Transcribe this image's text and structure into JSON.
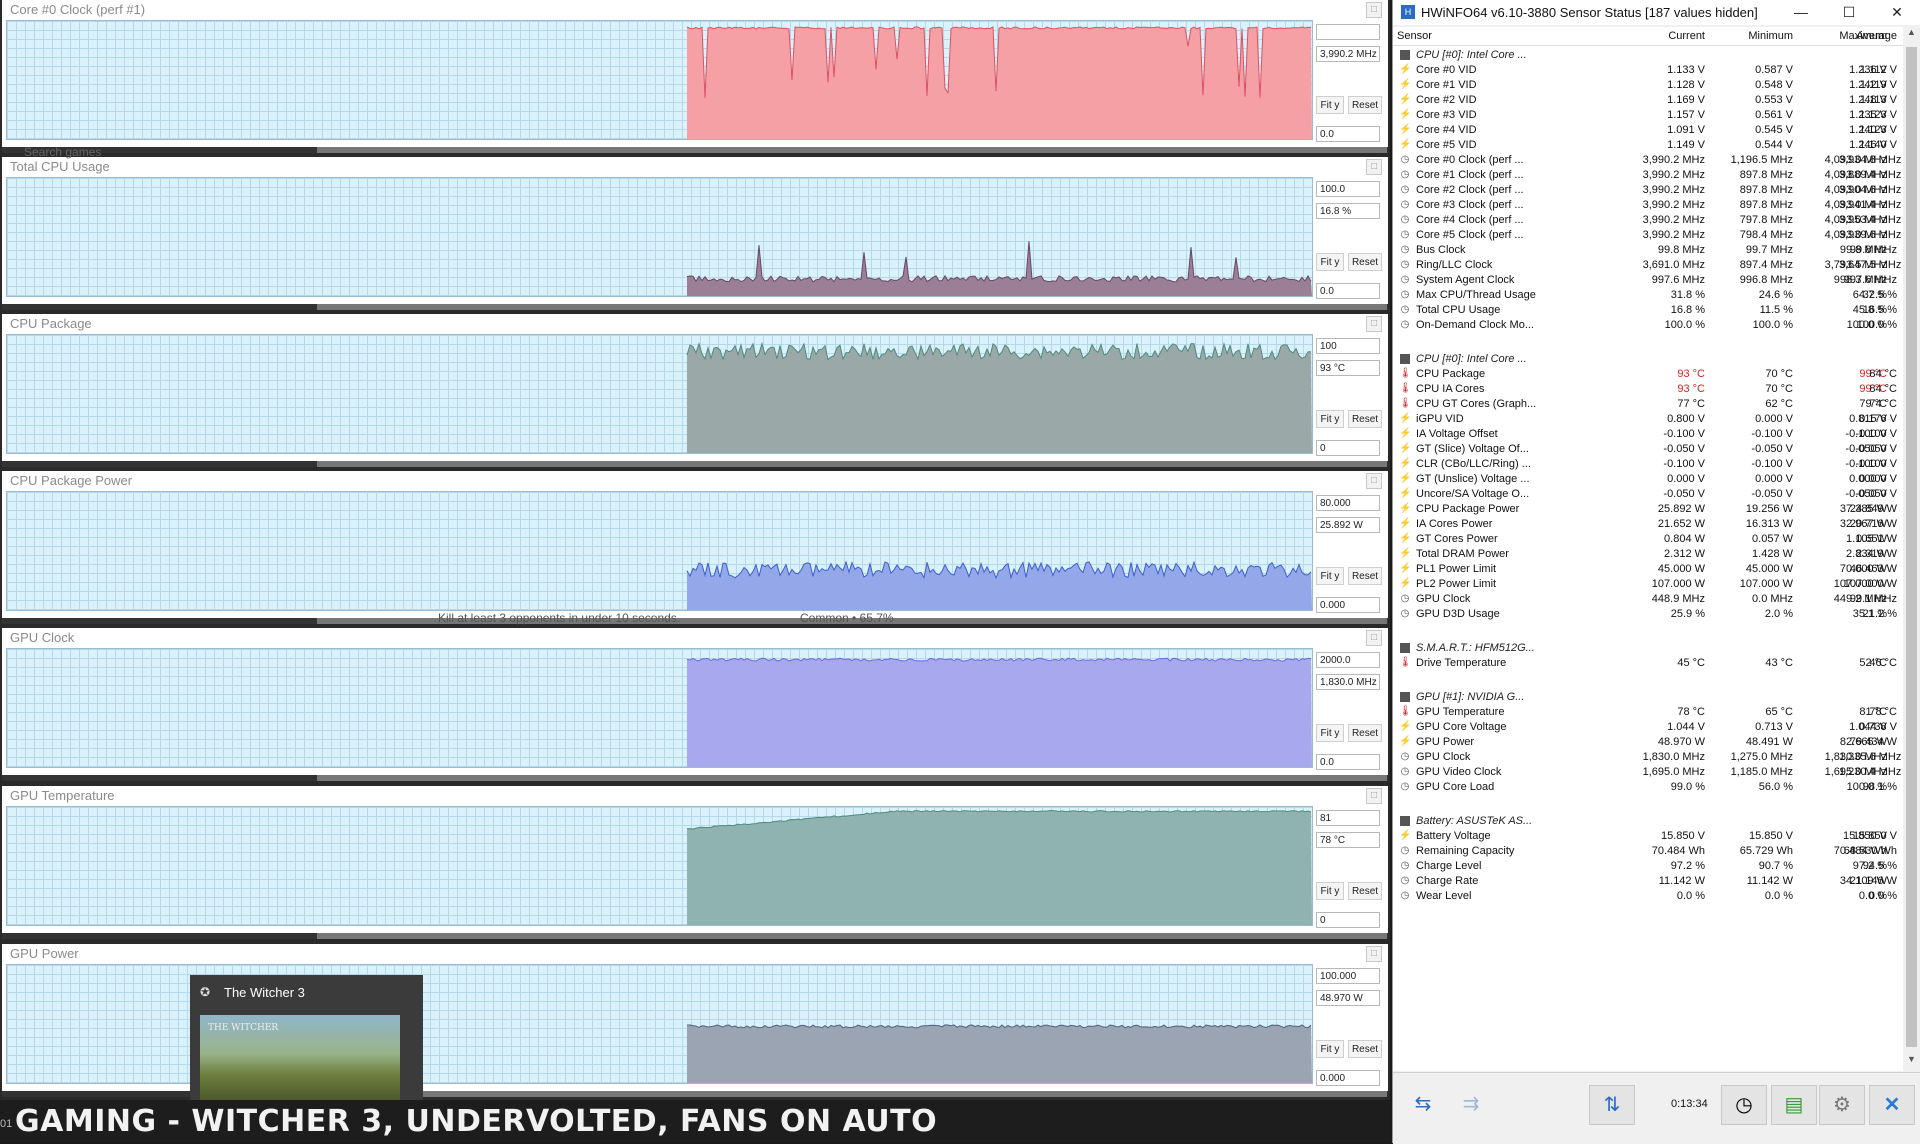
{
  "graphs": [
    {
      "title": "Core #0 Clock (perf #1)",
      "top_value": "",
      "current": "3,990.2 MHz",
      "bottom": "0.0",
      "fit": "Fit y",
      "reset": "Reset",
      "color": "#f4a0a4",
      "stroke": "#e05060",
      "baseline": 0.05,
      "shape": "dips"
    },
    {
      "title": "Total CPU Usage",
      "top_value": "100.0",
      "current": "16.8 %",
      "bottom": "0.0",
      "fit": "Fit y",
      "reset": "Reset",
      "color": "#9a7f96",
      "stroke": "#6a4766",
      "baseline": 0.88,
      "shape": "low"
    },
    {
      "title": "CPU Package",
      "top_value": "100",
      "current": "93 °C",
      "bottom": "0",
      "fit": "Fit y",
      "reset": "Reset",
      "color": "#9aa9a8",
      "stroke": "#4f8a7a",
      "baseline": 0.14,
      "shape": "noisy"
    },
    {
      "title": "CPU Package Power",
      "top_value": "80.000",
      "current": "25.892 W",
      "bottom": "0.000",
      "fit": "Fit y",
      "reset": "Reset",
      "color": "#93a7e9",
      "stroke": "#3c5fd0",
      "baseline": 0.66,
      "shape": "noisy"
    },
    {
      "title": "GPU Clock",
      "top_value": "2000.0",
      "current": "1,830.0 MHz",
      "bottom": "0.0",
      "fit": "Fit y",
      "reset": "Reset",
      "color": "#a8a8ee",
      "stroke": "#6a6ad8",
      "baseline": 0.09,
      "shape": "flat"
    },
    {
      "title": "GPU Temperature",
      "top_value": "81",
      "current": "78 °C",
      "bottom": "0",
      "fit": "Fit y",
      "reset": "Reset",
      "color": "#8fb3ae",
      "stroke": "#4f8a7a",
      "baseline": 0.03,
      "shape": "rise"
    },
    {
      "title": "GPU Power",
      "top_value": "100.000",
      "current": "48.970 W",
      "bottom": "0.000",
      "fit": "Fit y",
      "reset": "Reset",
      "color": "#9aa4b3",
      "stroke": "#4f5f80",
      "baseline": 0.52,
      "shape": "flat"
    }
  ],
  "overlay": {
    "search": "Search games",
    "challenge": "Kill at least 3 opponents in under 10 seconds.",
    "rarity": "Common • 65.7%",
    "popup_title": "The Witcher 3",
    "caption": "GAMING - WITCHER 3, UNDERVOLTED, FANS ON AUTO",
    "edge_label": "01"
  },
  "hwinfo": {
    "title": "HWiNFO64 v6.10-3880 Sensor Status [187 values hidden]",
    "columns": [
      "Sensor",
      "Current",
      "Minimum",
      "Maximum",
      "Average"
    ],
    "timer": "0:13:34",
    "rows": [
      {
        "type": "group",
        "name": "CPU [#0]: Intel Core ..."
      },
      {
        "icon": "bolt",
        "name": "Core #0 VID",
        "v": [
          "1.133 V",
          "0.587 V",
          "1.236 V",
          "1.112 V"
        ]
      },
      {
        "icon": "bolt",
        "name": "Core #1 VID",
        "v": [
          "1.128 V",
          "0.548 V",
          "1.242 V",
          "1.119 V"
        ]
      },
      {
        "icon": "bolt",
        "name": "Core #2 VID",
        "v": [
          "1.169 V",
          "0.553 V",
          "1.248 V",
          "1.113 V"
        ]
      },
      {
        "icon": "bolt",
        "name": "Core #3 VID",
        "v": [
          "1.157 V",
          "0.561 V",
          "1.235 V",
          "1.123 V"
        ]
      },
      {
        "icon": "bolt",
        "name": "Core #4 VID",
        "v": [
          "1.091 V",
          "0.545 V",
          "1.240 V",
          "1.123 V"
        ]
      },
      {
        "icon": "bolt",
        "name": "Core #5 VID",
        "v": [
          "1.149 V",
          "0.544 V",
          "1.246 V",
          "1.140 V"
        ]
      },
      {
        "icon": "clock",
        "name": "Core #0 Clock (perf ...",
        "v": [
          "3,990.2 MHz",
          "1,196.5 MHz",
          "4,093.0 MHz",
          "3,934.8 MHz"
        ]
      },
      {
        "icon": "clock",
        "name": "Core #1 Clock (perf ...",
        "v": [
          "3,990.2 MHz",
          "897.8 MHz",
          "4,093.0 MHz",
          "3,889.4 MHz"
        ]
      },
      {
        "icon": "clock",
        "name": "Core #2 Clock (perf ...",
        "v": [
          "3,990.2 MHz",
          "897.8 MHz",
          "4,093.0 MHz",
          "3,904.6 MHz"
        ]
      },
      {
        "icon": "clock",
        "name": "Core #3 Clock (perf ...",
        "v": [
          "3,990.2 MHz",
          "897.8 MHz",
          "4,093.0 MHz",
          "3,941.4 MHz"
        ]
      },
      {
        "icon": "clock",
        "name": "Core #4 Clock (perf ...",
        "v": [
          "3,990.2 MHz",
          "797.8 MHz",
          "4,093.0 MHz",
          "3,953.4 MHz"
        ]
      },
      {
        "icon": "clock",
        "name": "Core #5 Clock (perf ...",
        "v": [
          "3,990.2 MHz",
          "798.4 MHz",
          "4,093.0 MHz",
          "3,939.6 MHz"
        ]
      },
      {
        "icon": "clock",
        "name": "Bus Clock",
        "v": [
          "99.8 MHz",
          "99.7 MHz",
          "99.8 MHz",
          "99.8 MHz"
        ]
      },
      {
        "icon": "clock",
        "name": "Ring/LLC Clock",
        "v": [
          "3,691.0 MHz",
          "897.4 MHz",
          "3,793.5 MHz",
          "3,647.5 MHz"
        ]
      },
      {
        "icon": "clock",
        "name": "System Agent Clock",
        "v": [
          "997.6 MHz",
          "996.8 MHz",
          "998.3 MHz",
          "997.6 MHz"
        ]
      },
      {
        "icon": "clock",
        "name": "Max CPU/Thread Usage",
        "v": [
          "31.8 %",
          "24.6 %",
          "64.7 %",
          "32.5 %"
        ]
      },
      {
        "icon": "clock",
        "name": "Total CPU Usage",
        "v": [
          "16.8 %",
          "11.5 %",
          "45.8 %",
          "16.5 %"
        ]
      },
      {
        "icon": "clock",
        "name": "On-Demand Clock Mo...",
        "v": [
          "100.0 %",
          "100.0 %",
          "100.0 %",
          "100.0 %"
        ]
      },
      {
        "type": "spacer"
      },
      {
        "type": "group",
        "name": "CPU [#0]: Intel Core ..."
      },
      {
        "icon": "temp",
        "name": "CPU Package",
        "v": [
          "93 °C",
          "70 °C",
          "99 °C",
          "84 °C"
        ],
        "hot": [
          0,
          2
        ]
      },
      {
        "icon": "temp",
        "name": "CPU IA Cores",
        "v": [
          "93 °C",
          "70 °C",
          "99 °C",
          "84 °C"
        ],
        "hot": [
          0,
          2
        ]
      },
      {
        "icon": "temp",
        "name": "CPU GT Cores (Graph...",
        "v": [
          "77 °C",
          "62 °C",
          "79 °C",
          "74 °C"
        ]
      },
      {
        "icon": "bolt",
        "name": "iGPU VID",
        "v": [
          "0.800 V",
          "0.000 V",
          "0.815 V",
          "0.176 V"
        ]
      },
      {
        "icon": "bolt",
        "name": "IA Voltage Offset",
        "v": [
          "-0.100 V",
          "-0.100 V",
          "-0.100 V",
          "-0.100 V"
        ]
      },
      {
        "icon": "bolt",
        "name": "GT (Slice) Voltage Of...",
        "v": [
          "-0.050 V",
          "-0.050 V",
          "-0.050 V",
          "-0.050 V"
        ]
      },
      {
        "icon": "bolt",
        "name": "CLR (CBo/LLC/Ring) ...",
        "v": [
          "-0.100 V",
          "-0.100 V",
          "-0.100 V",
          "-0.100 V"
        ]
      },
      {
        "icon": "bolt",
        "name": "GT (Unslice) Voltage ...",
        "v": [
          "0.000 V",
          "0.000 V",
          "0.000 V",
          "0.000 V"
        ]
      },
      {
        "icon": "bolt",
        "name": "Uncore/SA Voltage O...",
        "v": [
          "-0.050 V",
          "-0.050 V",
          "-0.050 V",
          "-0.050 V"
        ]
      },
      {
        "icon": "bolt",
        "name": "CPU Package Power",
        "v": [
          "25.892 W",
          "19.256 W",
          "37.385 W",
          "24.849 W"
        ]
      },
      {
        "icon": "bolt",
        "name": "IA Cores Power",
        "v": [
          "21.652 W",
          "16.313 W",
          "32.967 W",
          "20.716 W"
        ]
      },
      {
        "icon": "bolt",
        "name": "GT Cores Power",
        "v": [
          "0.804 W",
          "0.057 W",
          "1.105 W",
          "0.651 W"
        ]
      },
      {
        "icon": "bolt",
        "name": "Total DRAM Power",
        "v": [
          "2.312 W",
          "1.428 W",
          "2.834 W",
          "2.319 W"
        ]
      },
      {
        "icon": "bolt",
        "name": "PL1 Power Limit",
        "v": [
          "45.000 W",
          "45.000 W",
          "70.000 W",
          "46.463 W"
        ]
      },
      {
        "icon": "bolt",
        "name": "PL2 Power Limit",
        "v": [
          "107.000 W",
          "107.000 W",
          "107.000 W",
          "107.000 W"
        ]
      },
      {
        "icon": "clock",
        "name": "GPU Clock",
        "v": [
          "448.9 MHz",
          "0.0 MHz",
          "449.2 MHz",
          "99.1 MHz"
        ]
      },
      {
        "icon": "clock",
        "name": "GPU D3D Usage",
        "v": [
          "25.9 %",
          "2.0 %",
          "35.1 %",
          "21.2 %"
        ]
      },
      {
        "type": "spacer"
      },
      {
        "type": "group",
        "name": "S.M.A.R.T.: HFM512G..."
      },
      {
        "icon": "temp",
        "name": "Drive Temperature",
        "v": [
          "45 °C",
          "43 °C",
          "52 °C",
          "46 °C"
        ]
      },
      {
        "type": "spacer"
      },
      {
        "type": "group",
        "name": "GPU [#1]: NVIDIA G..."
      },
      {
        "icon": "temp",
        "name": "GPU Temperature",
        "v": [
          "78 °C",
          "65 °C",
          "81 °C",
          "78 °C"
        ]
      },
      {
        "icon": "bolt",
        "name": "GPU Core Voltage",
        "v": [
          "1.044 V",
          "0.713 V",
          "1.044 V",
          "0.738 V"
        ]
      },
      {
        "icon": "bolt",
        "name": "GPU Power",
        "v": [
          "48.970 W",
          "48.491 W",
          "82.665 W",
          "79.434 W"
        ]
      },
      {
        "icon": "clock",
        "name": "GPU Clock",
        "v": [
          "1,830.0 MHz",
          "1,275.0 MHz",
          "1,830.0 MHz",
          "1,335.6 MHz"
        ]
      },
      {
        "icon": "clock",
        "name": "GPU Video Clock",
        "v": [
          "1,695.0 MHz",
          "1,185.0 MHz",
          "1,695.0 MHz",
          "1,230.4 MHz"
        ]
      },
      {
        "icon": "clock",
        "name": "GPU Core Load",
        "v": [
          "99.0 %",
          "56.0 %",
          "100.0 %",
          "98.1 %"
        ]
      },
      {
        "type": "spacer"
      },
      {
        "type": "group",
        "name": "Battery: ASUSTeK AS..."
      },
      {
        "icon": "bolt",
        "name": "Battery Voltage",
        "v": [
          "15.850 V",
          "15.850 V",
          "15.850 V",
          "15.850 V"
        ]
      },
      {
        "icon": "clock",
        "name": "Remaining Capacity",
        "v": [
          "70.484 Wh",
          "65.729 Wh",
          "70.484 Wh",
          "68.530 Wh"
        ]
      },
      {
        "icon": "clock",
        "name": "Charge Level",
        "v": [
          "97.2 %",
          "90.7 %",
          "97.2 %",
          "94.5 %"
        ]
      },
      {
        "icon": "clock",
        "name": "Charge Rate",
        "v": [
          "11.142 W",
          "11.142 W",
          "34.109 W",
          "21.146 W"
        ]
      },
      {
        "icon": "clock",
        "name": "Wear Level",
        "v": [
          "0.0 %",
          "0.0 %",
          "0.0 %",
          "0.0 %"
        ]
      }
    ]
  }
}
